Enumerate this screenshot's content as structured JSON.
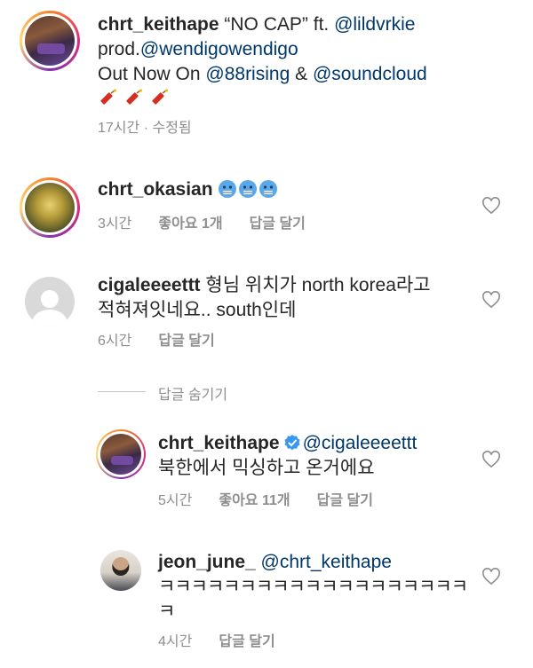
{
  "caption": {
    "username": "chrt_keithape",
    "text1": " “NO CAP” ft. ",
    "mention1": "@lildvrkie",
    "line2_prefix": "prod.",
    "mention2": "@wendigowendigo",
    "line3_prefix": "Out Now On ",
    "mention3": "@88rising",
    "amp": " & ",
    "mention4": "@soundcloud",
    "emoji_icon": "firecracker-icon",
    "emoji_count": 3,
    "time": "17시간",
    "edited": " · 수정됨"
  },
  "comments": [
    {
      "username": "chrt_okasian",
      "text": "",
      "emoji_icon": "cold-face-icon",
      "time": "3시간",
      "likes": "좋아요 1개",
      "reply": "답글 달기"
    },
    {
      "username": "cigaleeeettt",
      "text_line1": " 형님 위치가 north korea라고",
      "text_line2": "적혀져잇네요.. south인데",
      "time": "6시간",
      "reply": "답글 달기"
    }
  ],
  "hide_replies": "답글 숨기기",
  "replies": [
    {
      "username": "chrt_keithape",
      "mention": "@cigaleeeettt",
      "text": "북한에서 믹싱하고 온거에요",
      "time": "5시간",
      "likes": "좋아요 11개",
      "reply": "답글 달기"
    },
    {
      "username": "jeon_june_",
      "mention": "@chrt_keithape",
      "text_line1": "ㅋㅋㅋㅋㅋㅋㅋㅋㅋㅋㅋㅋㅋㅋㅋㅋㅋㅋㅋ",
      "text_line2": "ㅋ",
      "time": "4시간",
      "reply": "답글 달기"
    }
  ],
  "colors": {
    "mention": "#00376b",
    "meta": "#8e8e8e",
    "verified": "#3897f0"
  }
}
